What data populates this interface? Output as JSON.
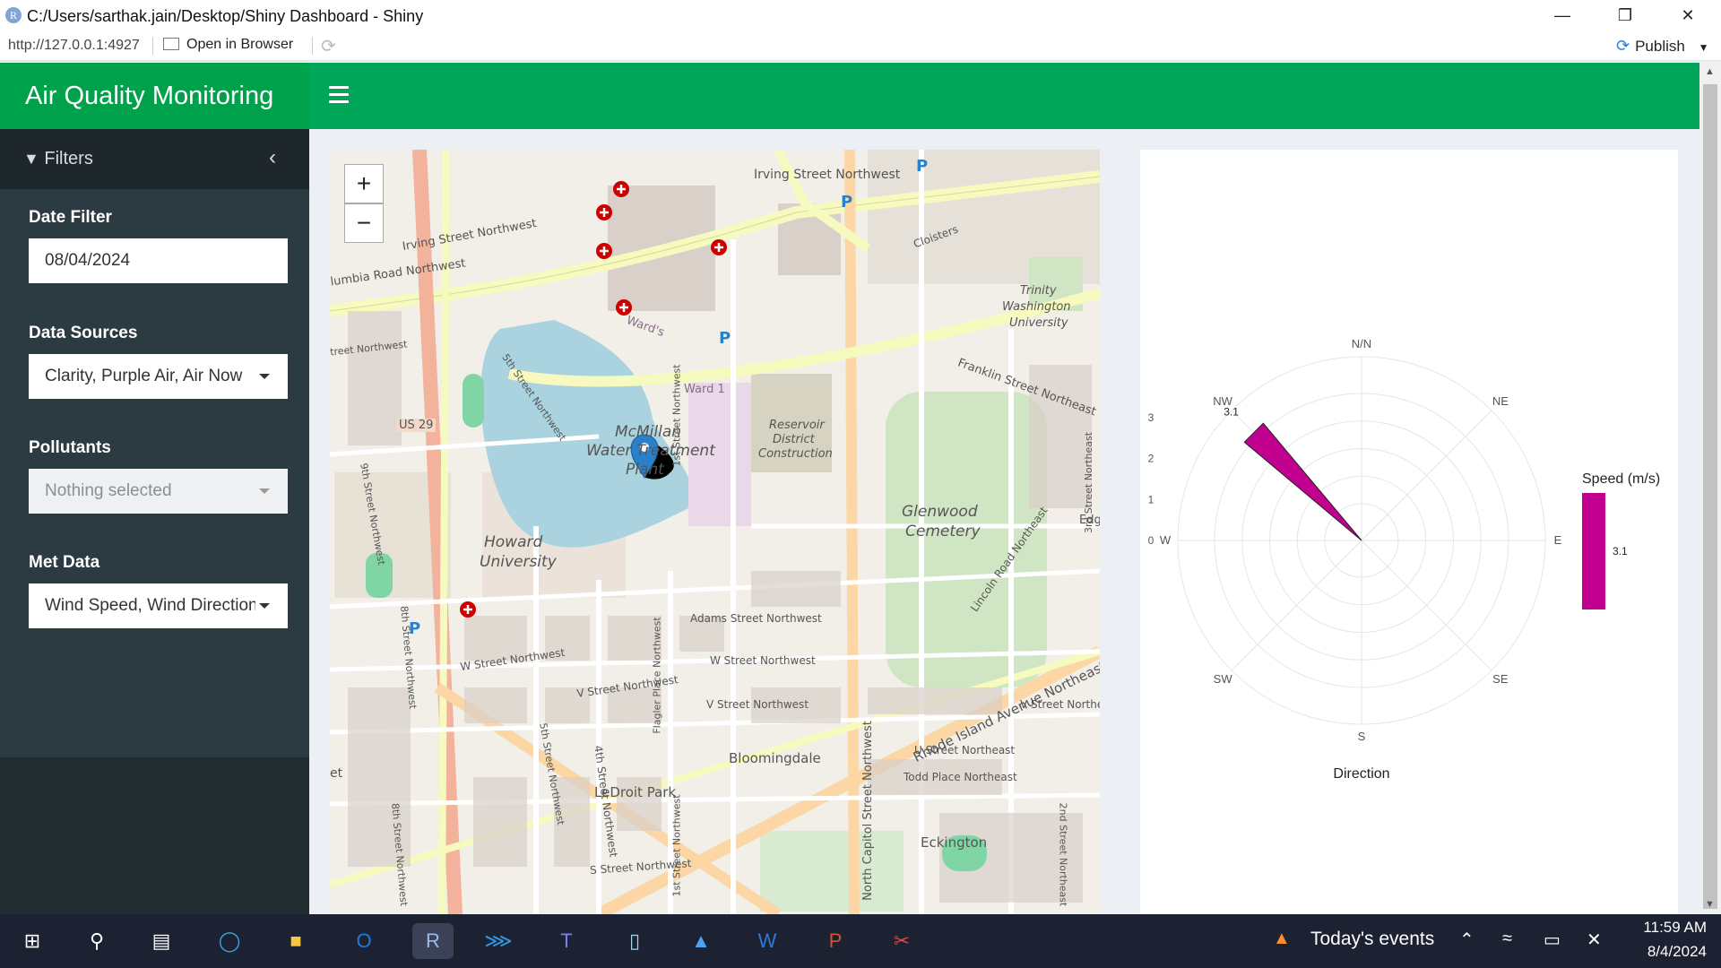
{
  "window": {
    "title": "C:/Users/sarthak.jain/Desktop/Shiny Dashboard - Shiny",
    "url": "http://127.0.0.1:4927",
    "open_in_browser": "Open in Browser",
    "publish": "Publish"
  },
  "header": {
    "app_title": "Air Quality Monitoring"
  },
  "sidebar": {
    "filters_label": "Filters",
    "date_filter_label": "Date Filter",
    "date_filter_value": "08/04/2024",
    "data_sources_label": "Data Sources",
    "data_sources_value": "Clarity, Purple Air, Air Now",
    "pollutants_label": "Pollutants",
    "pollutants_placeholder": "Nothing selected",
    "met_data_label": "Met Data",
    "met_data_value": "Wind Speed, Wind Direction"
  },
  "map": {
    "zoom_in": "+",
    "zoom_out": "−",
    "labels": {
      "irving_nw_1": "Irving Street Northwest",
      "irving_nw_2": "Irving Street Northwest",
      "columbia": "lumbia Road Northwest",
      "street_nw_left": "treet Northwest",
      "us29": "US 29",
      "ward1": "Ward 1",
      "wards": "Ward's",
      "mcmillan": "McMillan",
      "water_treatment": "Water Treatment",
      "plant": "Plant",
      "reservoir": "Reservoir",
      "district": "District",
      "construction": "Construction",
      "franklin": "Franklin Street Northeast",
      "glenwood": "Glenwood",
      "cemetery": "Cemetery",
      "howard": "Howard",
      "university": "University",
      "trinity": "Trinity",
      "washington": "Washington",
      "university2": "University",
      "cloisters": "Cloisters",
      "adams": "Adams Street Northwest",
      "w_street_1": "W Street Northwest",
      "w_street_2": "W Street Northwest",
      "v_street_1": "V Street Northwest",
      "v_street_2": "V Street Northwest",
      "bloomingdale": "Bloomingdale",
      "ledroit": "LeDroit Park",
      "rhode_island": "Rhode Island Avenue Northeast",
      "u_street_ne": "U Street Northeast",
      "todd_place": "Todd Place Northeast",
      "v_street_ne": "V Street Northeast",
      "north_capitol": "North Capitol Street Northwest",
      "lincoln_road": "Lincoln Road Northeast",
      "eckington": "Eckington",
      "s_street": "S Street Northwest",
      "edg": "Edg",
      "third_street": "3rd Street Northeast",
      "second_street": "2nd Street Northeast",
      "fifth_street": "5th Street Northwest",
      "fourth_street": "4th Street Northwest",
      "flagler": "Flagler Place Northwest",
      "ninth_street": "9th Street Northwest",
      "eighth_street": "8th Street Northwest",
      "first_street": "1st Street Northwest",
      "north_et": "et",
      "parking": "P"
    }
  },
  "chart_data": {
    "type": "windrose",
    "xlabel": "Direction",
    "directions": [
      "N/N",
      "NE",
      "E",
      "SE",
      "S",
      "SW",
      "W",
      "NW"
    ],
    "r_ticks": [
      "0",
      "1",
      "2",
      "3"
    ],
    "rlim": [
      0,
      3.5
    ],
    "series": [
      {
        "name": "3.1",
        "direction": "NW",
        "angle_deg": 315,
        "value": 3.1,
        "color": "#c2008f"
      }
    ],
    "bar_label": "3.1",
    "legend": {
      "title": "Speed (m/s)",
      "entries": [
        "3.1"
      ],
      "color": "#c2008f",
      "position": "right"
    }
  },
  "taskbar": {
    "events": "Today's events",
    "time": "11:59 AM",
    "date": "8/4/2024"
  },
  "colors": {
    "header_green": "#00a65a",
    "sidebar_dark": "#222d32",
    "rose_magenta": "#c2008f"
  }
}
